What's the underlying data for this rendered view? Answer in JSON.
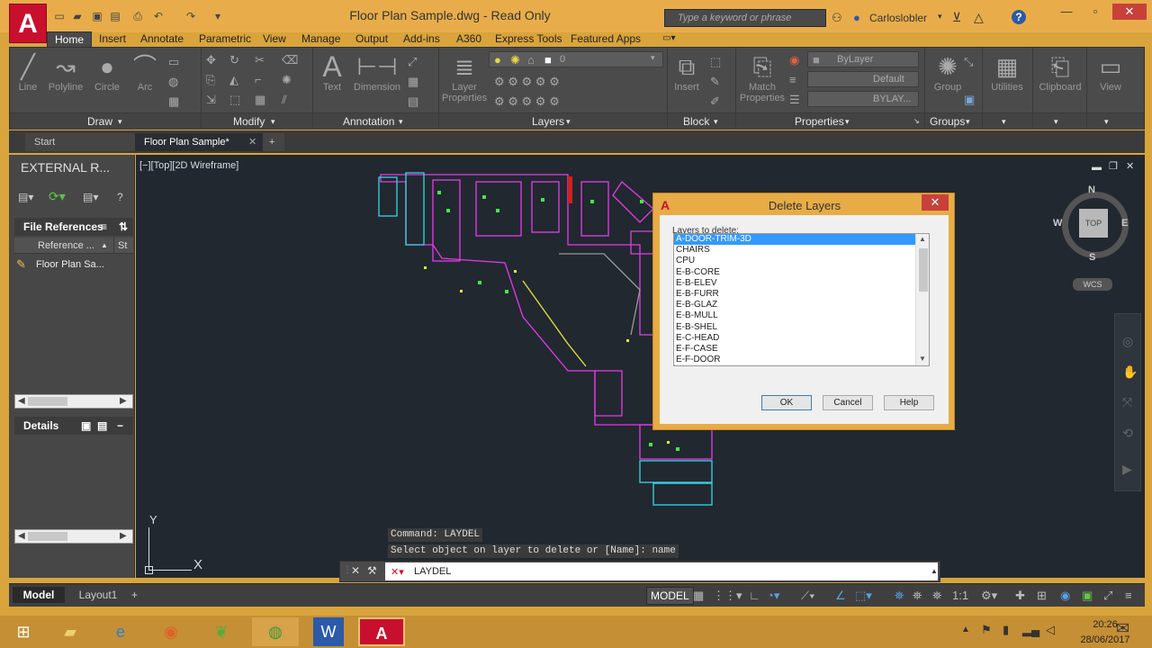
{
  "window": {
    "title": "Floor Plan Sample.dwg - Read Only",
    "logo": "A",
    "search_placeholder": "Type a keyword or phrase",
    "user": "Carloslobler",
    "help": "?"
  },
  "ribbon_tabs": [
    "Home",
    "Insert",
    "Annotate",
    "Parametric",
    "View",
    "Manage",
    "Output",
    "Add-ins",
    "A360",
    "Express Tools",
    "Featured Apps"
  ],
  "ribbon": {
    "draw_tools": [
      "Line",
      "Polyline",
      "Circle",
      "Arc"
    ],
    "annotation_tools": [
      "Text",
      "Dimension"
    ],
    "layer_properties": "Layer Properties",
    "layer_combo": "0",
    "insert": "Insert",
    "match_properties": "Match Properties",
    "bylayer": "ByLayer",
    "default_lineweight": "Default",
    "bylayer_linetype": "BYLAY...",
    "group": "Group",
    "utilities": "Utilities",
    "clipboard": "Clipboard",
    "view": "View",
    "panels": [
      "Draw",
      "Modify",
      "Annotation",
      "Layers",
      "Block",
      "Properties",
      "Groups"
    ]
  },
  "doc_tabs": {
    "start": "Start",
    "current": "Floor Plan Sample*"
  },
  "palette": {
    "title": "EXTERNAL R...",
    "file_references": "File References",
    "col_reference": "Reference ...",
    "col_status": "St",
    "item": "Floor Plan Sa...",
    "details": "Details"
  },
  "viewport_label": "[−][Top][2D Wireframe]",
  "dialog": {
    "title": "Delete Layers",
    "label": "Layers to delete:",
    "layers": [
      "A-DOOR-TRIM-3D",
      "CHAIRS",
      "CPU",
      "E-B-CORE",
      "E-B-ELEV",
      "E-B-FURR",
      "E-B-GLAZ",
      "E-B-MULL",
      "E-B-SHEL",
      "E-C-HEAD",
      "E-F-CASE",
      "E-F-DOOR"
    ],
    "selected_index": 0,
    "ok": "OK",
    "cancel": "Cancel",
    "help": "Help"
  },
  "command": {
    "history_1": "Command: LAYDEL",
    "history_2": "Select object on layer to delete or [Name]: name",
    "input": "LAYDEL"
  },
  "viewcube": {
    "n": "N",
    "s": "S",
    "e": "E",
    "w": "W",
    "top": "TOP",
    "wcs": "WCS"
  },
  "ucs": {
    "x": "X",
    "y": "Y"
  },
  "status": {
    "model_tab": "Model",
    "layout_tab": "Layout1",
    "model_button": "MODEL",
    "scale": "1:1"
  },
  "taskbar": {
    "time": "20:26",
    "date": "28/06/2017"
  }
}
